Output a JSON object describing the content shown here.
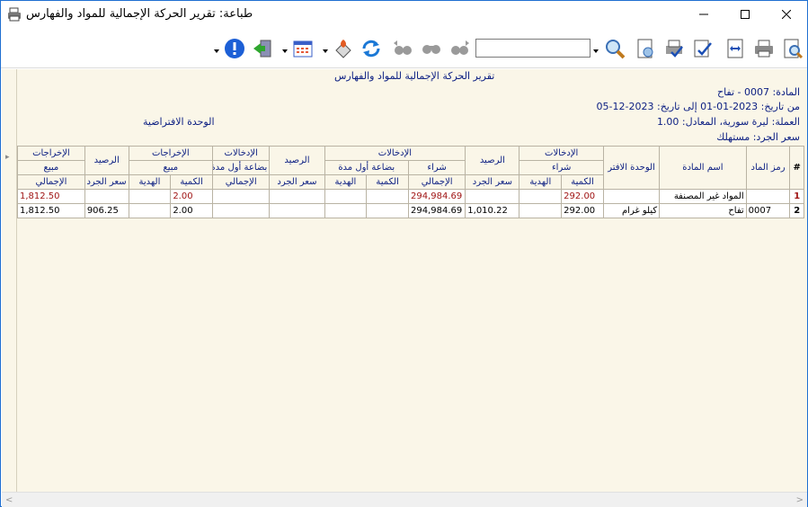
{
  "window": {
    "title": "طباعة: تقرير الحركة الإجمالية للمواد والفهارس"
  },
  "toolbar": {
    "search_value": "",
    "buttons": [
      "info-icon",
      "exit-icon",
      "calendar-icon",
      "fill-icon",
      "refresh-icon",
      "binoculars-back-icon",
      "binoculars-icon",
      "binoculars-forward-icon",
      "search-icon",
      "page-setup-icon",
      "print-check-icon",
      "edit-check-icon",
      "fit-width-icon",
      "printer-icon",
      "preview-icon"
    ]
  },
  "report": {
    "title": "تقرير الحركة الإجمالية للمواد والفهارس",
    "material_line": "المادة: 0007 - تفاح",
    "date_line": "من تاريخ: 2023-01-01 إلى تاريخ: 2023-12-05",
    "currency_line": "العملة: ليرة سورية، المعادل: 1.00",
    "unit_line": "الوحدة الافتراضية",
    "price_line": "سعر الجرد: مستهلك"
  },
  "table": {
    "h1": {
      "hash": "#",
      "code": "رمز الماد",
      "name": "اسم المادة",
      "unit": "الوحدة الافتر",
      "in1": "الإدخالات",
      "bal1": "الرصيد",
      "in2": "الإدخالات",
      "bal2": "الرصيد",
      "in3": "الإدخالات",
      "out1": "الإخراجات",
      "bal3": "الرصيد",
      "out2": "الإخراجات"
    },
    "h2": {
      "buy1": "شراء",
      "buy2": "شراء",
      "opening2": "بضاعة أول مدة",
      "opening3": "بضاعة أول مدة",
      "sale1": "مبيع",
      "sale2": "مبيع"
    },
    "h3": {
      "qty": "الكمية",
      "gift": "الهدية",
      "inv_price": "سعر الجرد",
      "total": "الإجمالي"
    },
    "rows": [
      {
        "idx": "1",
        "code": "",
        "name": "المواد غير المصنفة",
        "unit": "",
        "buy_qty": "292.00",
        "buy_gift": "",
        "bal1_price": "",
        "buy_total": "294,984.69",
        "op_qty": "",
        "op_gift": "",
        "bal2_price": "",
        "op_total": "",
        "sale_qty": "2.00",
        "sale_gift": "",
        "bal3_price": "",
        "sale_total": "1,812.50"
      },
      {
        "idx": "2",
        "code": "0007",
        "name": "تفاح",
        "unit": "كيلو غرام",
        "buy_qty": "292.00",
        "buy_gift": "",
        "bal1_price": "1,010.22",
        "buy_total": "294,984.69",
        "op_qty": "",
        "op_gift": "",
        "bal2_price": "",
        "op_total": "",
        "sale_qty": "2.00",
        "sale_gift": "",
        "bal3_price": "906.25",
        "sale_total": "1,812.50"
      }
    ]
  },
  "colors": {
    "header_text": "#0b1e82",
    "red_value": "#a01515",
    "report_bg": "#faf6e8",
    "window_border": "#1f6fd1"
  }
}
